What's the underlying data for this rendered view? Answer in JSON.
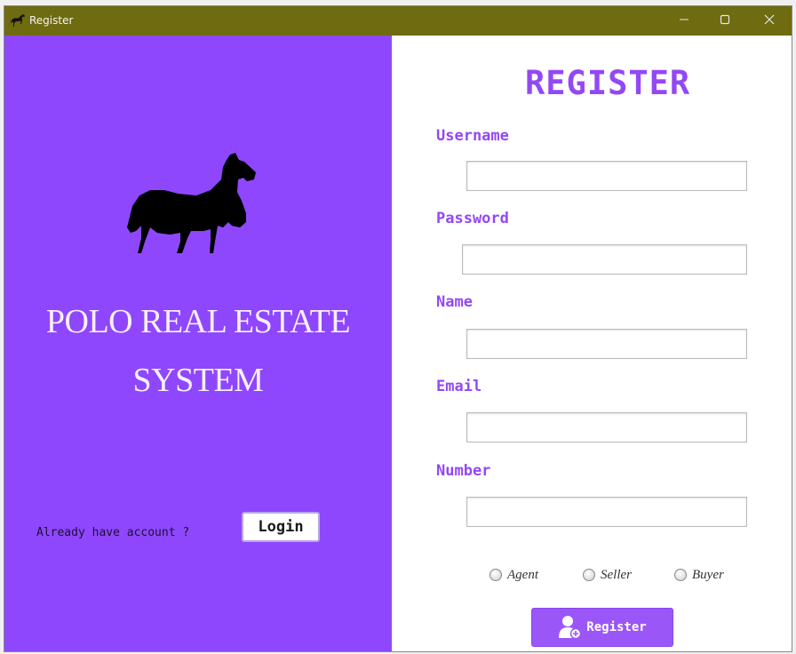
{
  "window": {
    "title": "Register",
    "titlebar_color": "#6e6b11",
    "minimize_icon": "minimize-icon",
    "maximize_icon": "maximize-icon",
    "close_icon": "close-icon"
  },
  "left_panel": {
    "background": "#8f47fd",
    "logo_icon": "horse-icon",
    "brand_line1": "POLO REAL ESTATE",
    "brand_line2": "SYSTEM",
    "already_text": "Already have account ?",
    "login_label": "Login"
  },
  "form": {
    "heading": "REGISTER",
    "accent_color": "#9348f5",
    "fields": [
      {
        "label": "Username",
        "value": ""
      },
      {
        "label": "Password",
        "value": ""
      },
      {
        "label": "Name",
        "value": ""
      },
      {
        "label": "Email",
        "value": ""
      },
      {
        "label": "Number",
        "value": ""
      }
    ],
    "roles": [
      {
        "label": "Agent",
        "selected": false
      },
      {
        "label": "Seller",
        "selected": false
      },
      {
        "label": "Buyer",
        "selected": false
      }
    ],
    "register_label": "Register",
    "register_icon": "user-add-icon"
  }
}
